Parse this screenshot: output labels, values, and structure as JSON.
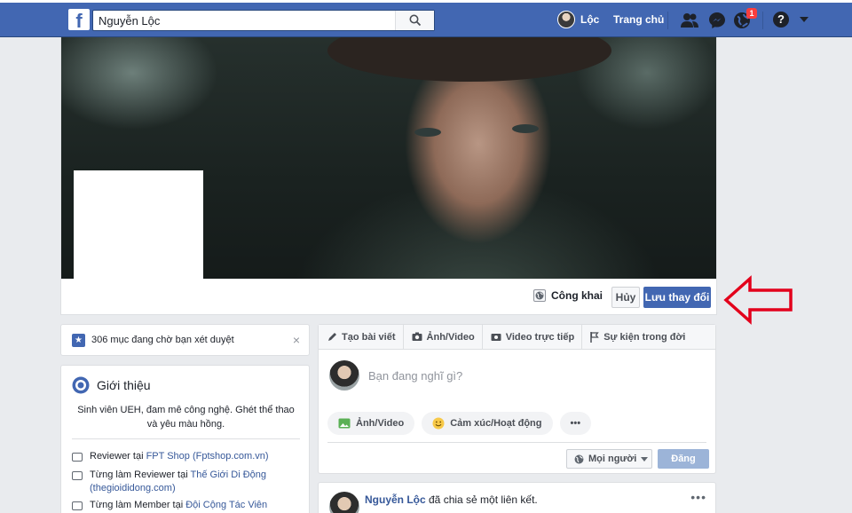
{
  "header": {
    "logo": "f",
    "search_value": "Nguyễn Lộc",
    "user_name": "Lộc",
    "home_label": "Trang chủ",
    "notification_count": "1",
    "help_label": "?"
  },
  "cover": {
    "privacy_label": "Công khai",
    "cancel_label": "Hủy",
    "save_label": "Lưu thay đổi"
  },
  "pending": {
    "text": "306 mục đang chờ bạn xét duyệt",
    "close": "×",
    "star": "★"
  },
  "intro": {
    "title": "Giới thiệu",
    "bio_line1": "Sinh viên UEH, đam mê công nghệ. Ghét thể thao",
    "bio_line2": "và yêu màu hồng.",
    "items": [
      {
        "prefix": "Reviewer tại ",
        "link": "FPT Shop (Fptshop.com.vn)",
        "sub": ""
      },
      {
        "prefix": "Từng làm Reviewer tại ",
        "link": "Thế Giới Di Động",
        "sub": "(thegioididong.com)"
      },
      {
        "prefix": "Từng làm Member tại ",
        "link": "Đội Cộng Tác Viên",
        "sub": ""
      }
    ]
  },
  "composer": {
    "tabs": [
      {
        "label": "Tạo bài viết",
        "icon": "pencil-icon"
      },
      {
        "label": "Ảnh/Video",
        "icon": "camera-icon"
      },
      {
        "label": "Video trực tiếp",
        "icon": "live-video-icon"
      },
      {
        "label": "Sự kiện trong đời",
        "icon": "flag-icon"
      }
    ],
    "placeholder": "Bạn đang nghĩ gì?",
    "actions": [
      {
        "label": "Ảnh/Video",
        "icon": "photo-icon"
      },
      {
        "label": "Cảm xúc/Hoạt động",
        "icon": "smiley-icon"
      },
      {
        "label": "•••",
        "icon": "more-icon"
      }
    ],
    "audience_label": "Mọi người",
    "post_label": "Đăng"
  },
  "feed": {
    "name": "Nguyễn Lộc",
    "action": " đã chia sẻ một liên kết.",
    "more": "•••"
  },
  "colors": {
    "brand": "#4267b2",
    "arrow": "#e3001b"
  }
}
